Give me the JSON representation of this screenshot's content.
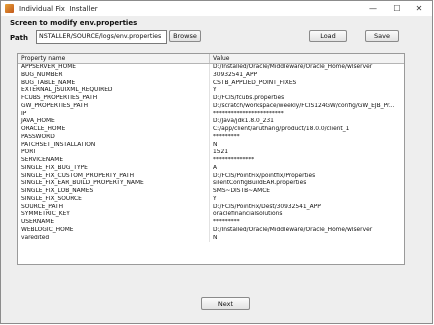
{
  "window": {
    "title": "Individual Fix  Installer",
    "minimize_glyph": "—",
    "maximize_glyph": "☐",
    "close_glyph": "✕"
  },
  "heading": "Screen to modify env.properties",
  "path": {
    "label": "Path",
    "value": "NSTALLER/SOURCE/logs/env.properties"
  },
  "buttons": {
    "browse": "Browse",
    "load": "Load",
    "save": "Save",
    "next": "Next"
  },
  "table": {
    "headers": [
      "Property name",
      "Value"
    ],
    "rows": [
      [
        "APPSERVER_HOME",
        "D:/Installed/Oracle/Middleware/Oracle_Home/wlserver"
      ],
      [
        "BUG_NUMBER",
        "30932541_APP"
      ],
      [
        "BUG_TABLE_NAME",
        "CSTB_APPLIED_POINT_FIXES"
      ],
      [
        "EXTERNAL_JSUIXML_REQUIRED",
        "Y"
      ],
      [
        "FCUBS_PROPERTIES_PATH",
        "D:/FCIS/fcubs.properties"
      ],
      [
        "GW_PROPERTIES_PATH",
        "D:/scratch/workspace/weekly/FCIS124GW/config/GW_EJB_Pr..."
      ],
      [
        "IP",
        "************************"
      ],
      [
        "JAVA_HOME",
        "D:/Java/jdk1.8.0_231"
      ],
      [
        "ORACLE_HOME",
        "C:/app/client/aruthang/product/18.0.0/client_1"
      ],
      [
        "PASSWORD",
        "*********"
      ],
      [
        "PATCHSET_INSTALLATION",
        "N"
      ],
      [
        "PORT",
        "1521"
      ],
      [
        "SERVICENAME",
        "**************"
      ],
      [
        "SINGLE_FIX_BUG_TYPE",
        "A"
      ],
      [
        "SINGLE_FIX_CUSTOM_PROPERTY_PATH",
        "D:/FCIS/PointFix/pointfix/Properties"
      ],
      [
        "SINGLE_FIX_EAR_BUILD_PROPERTY_NAME",
        "silentConfigBuildEAR.properties"
      ],
      [
        "SINGLE_FIX_LOB_NAMES",
        "SMS~DISTB~AMCE"
      ],
      [
        "SINGLE_FIX_SOURCE",
        "Y"
      ],
      [
        "SOURCE_PATH",
        "D:/FCIS/PointFix/Dest/30932541_APP"
      ],
      [
        "SYMMETRIC_KEY",
        "oraclefinancialsolutions"
      ],
      [
        "USERNAME",
        "*********"
      ],
      [
        "WEBLOGIC_HOME",
        "D:/Installed/Oracle/Middleware/Oracle_Home/wlserver"
      ],
      [
        "varedited",
        "N"
      ]
    ]
  }
}
